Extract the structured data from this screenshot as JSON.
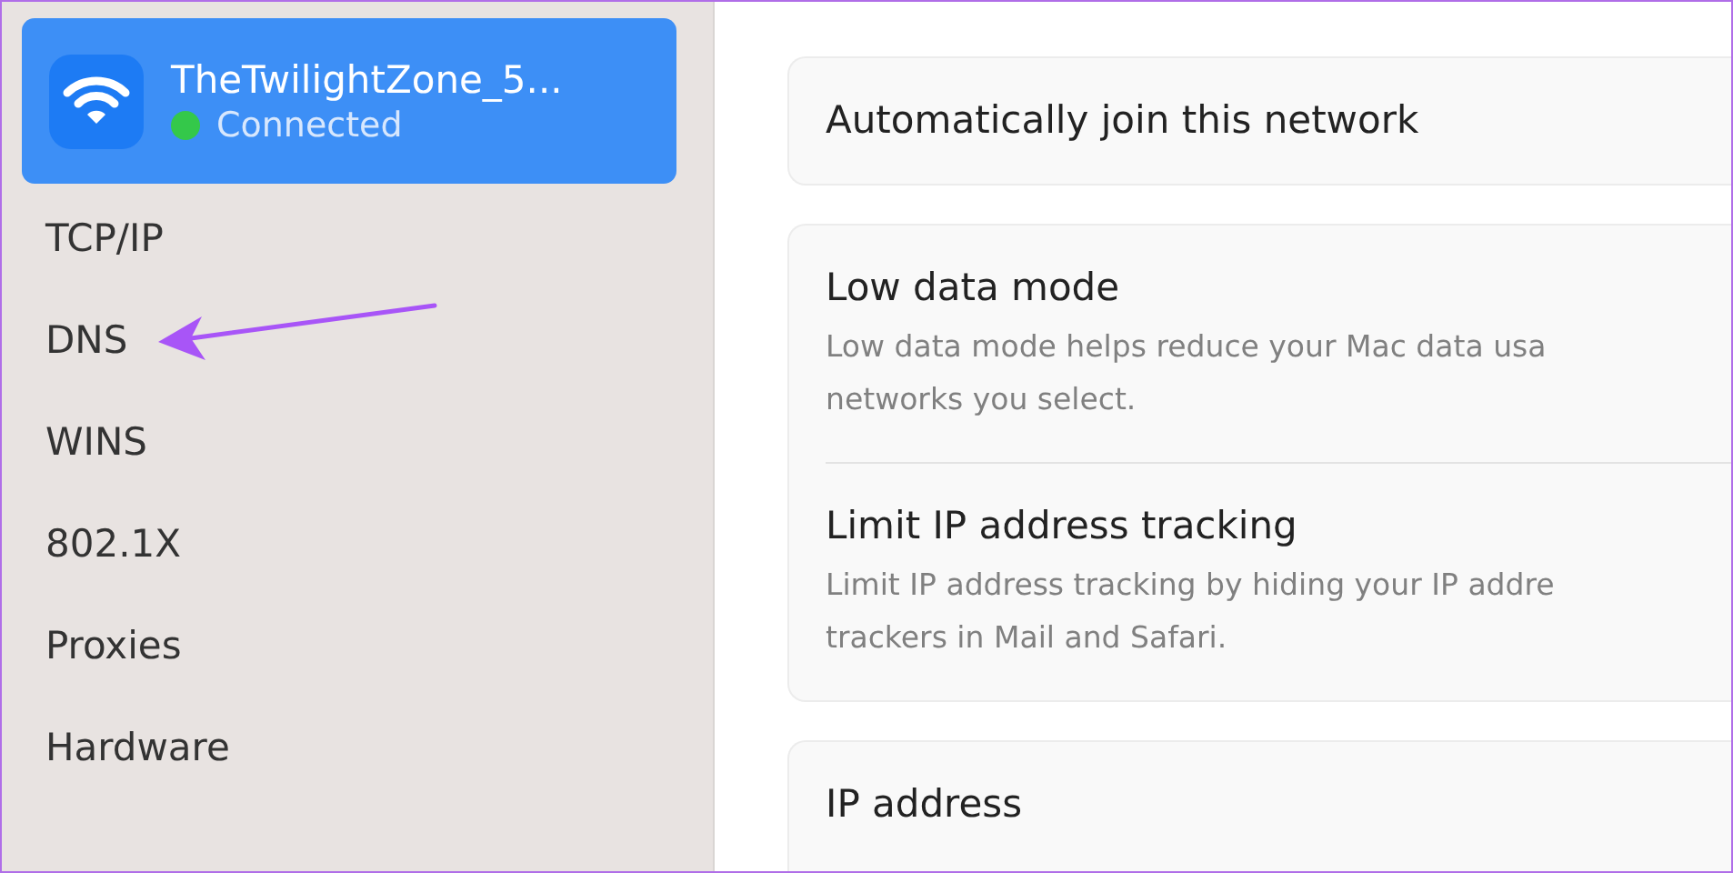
{
  "sidebar": {
    "network": {
      "name": "TheTwilightZone_5...",
      "status": "Connected",
      "color": "#34c84a",
      "selected": true
    },
    "items": [
      {
        "label": "TCP/IP",
        "selected": false
      },
      {
        "label": "DNS",
        "selected": false
      },
      {
        "label": "WINS",
        "selected": false
      },
      {
        "label": "802.1X",
        "selected": false
      },
      {
        "label": "Proxies",
        "selected": false
      },
      {
        "label": "Hardware",
        "selected": false
      }
    ]
  },
  "settings": [
    {
      "rows": [
        {
          "title": "Automatically join this network"
        }
      ]
    },
    {
      "rows": [
        {
          "title": "Low data mode",
          "description": [
            "Low data mode helps reduce your Mac data usa",
            "networks you select."
          ]
        },
        {
          "title": "Limit IP address tracking",
          "description": [
            "Limit IP address tracking by hiding your IP addre",
            "trackers in Mail and Safari."
          ]
        }
      ]
    },
    {
      "rows": [
        {
          "title": "IP address"
        }
      ]
    }
  ]
}
